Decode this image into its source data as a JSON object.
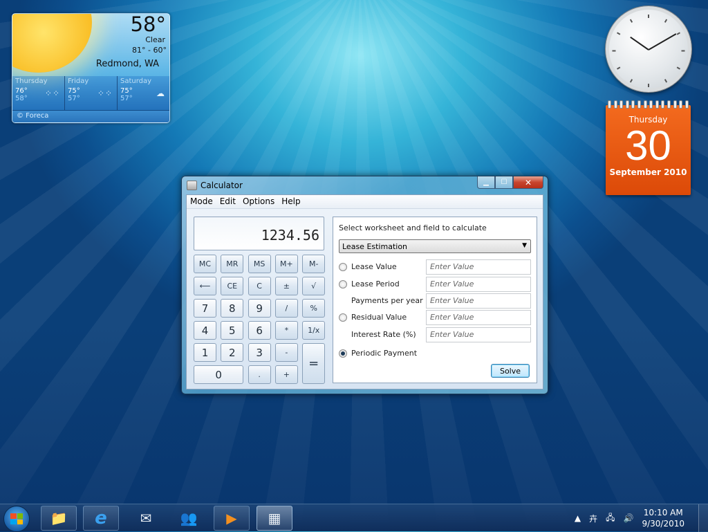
{
  "weather": {
    "temperature": "58°",
    "condition": "Clear",
    "range": "81° - 60°",
    "city": "Redmond, WA",
    "forecast": [
      {
        "day": "Thursday",
        "high": "76°",
        "low": "58°",
        "icon": "clear-night-icon"
      },
      {
        "day": "Friday",
        "high": "75°",
        "low": "57°",
        "icon": "clear-night-icon"
      },
      {
        "day": "Saturday",
        "high": "75°",
        "low": "57°",
        "icon": "cloudy-icon"
      }
    ],
    "credit": "© Foreca"
  },
  "clock": {
    "hour": 10,
    "minute": 10
  },
  "calendar": {
    "weekday": "Thursday",
    "day": "30",
    "month_year": "September 2010"
  },
  "calculator": {
    "title": "Calculator",
    "menu": [
      "Mode",
      "Edit",
      "Options",
      "Help"
    ],
    "display": "1234.56",
    "keys": [
      {
        "label": "MC",
        "num": false
      },
      {
        "label": "MR",
        "num": false
      },
      {
        "label": "MS",
        "num": false
      },
      {
        "label": "M+",
        "num": false
      },
      {
        "label": "M-",
        "num": false
      },
      {
        "label": "⟵",
        "num": false
      },
      {
        "label": "CE",
        "num": false
      },
      {
        "label": "C",
        "num": false
      },
      {
        "label": "±",
        "num": false
      },
      {
        "label": "√",
        "num": false
      },
      {
        "label": "7",
        "num": true
      },
      {
        "label": "8",
        "num": true
      },
      {
        "label": "9",
        "num": true
      },
      {
        "label": "/",
        "num": false
      },
      {
        "label": "%",
        "num": false
      },
      {
        "label": "4",
        "num": true
      },
      {
        "label": "5",
        "num": true
      },
      {
        "label": "6",
        "num": true
      },
      {
        "label": "*",
        "num": false
      },
      {
        "label": "1/x",
        "num": false
      },
      {
        "label": "1",
        "num": true
      },
      {
        "label": "2",
        "num": true
      },
      {
        "label": "3",
        "num": true
      },
      {
        "label": "-",
        "num": false
      },
      {
        "label": "=",
        "num": false
      },
      {
        "label": "0",
        "num": true
      },
      {
        "label": ".",
        "num": false
      },
      {
        "label": "+",
        "num": false
      }
    ],
    "worksheet": {
      "header": "Select worksheet and field to calculate",
      "selected": "Lease Estimation",
      "fields": [
        {
          "label": "Lease Value",
          "radio": true,
          "checked": false,
          "placeholder": "Enter Value"
        },
        {
          "label": "Lease Period",
          "radio": true,
          "checked": false,
          "placeholder": "Enter Value"
        },
        {
          "label": "Payments per year",
          "radio": false,
          "checked": false,
          "placeholder": "Enter Value"
        },
        {
          "label": "Residual Value",
          "radio": true,
          "checked": false,
          "placeholder": "Enter Value"
        },
        {
          "label": "Interest Rate (%)",
          "radio": false,
          "checked": false,
          "placeholder": "Enter Value"
        },
        {
          "label": "Periodic Payment",
          "radio": true,
          "checked": true,
          "placeholder": null
        }
      ],
      "solve_label": "Solve"
    }
  },
  "taskbar": {
    "items": [
      {
        "name": "windows-explorer",
        "icon": "📁",
        "pinned": true,
        "active": false
      },
      {
        "name": "internet-explorer",
        "icon": "e",
        "pinned": true,
        "active": false
      },
      {
        "name": "windows-live-mail",
        "icon": "✉",
        "pinned": false,
        "active": false
      },
      {
        "name": "windows-live-messenger",
        "icon": "👥",
        "pinned": false,
        "active": false
      },
      {
        "name": "windows-media-player",
        "icon": "▶",
        "pinned": true,
        "active": false
      },
      {
        "name": "calculator",
        "icon": "▦",
        "pinned": true,
        "active": true
      }
    ],
    "time": "10:10 AM",
    "date": "9/30/2010"
  }
}
